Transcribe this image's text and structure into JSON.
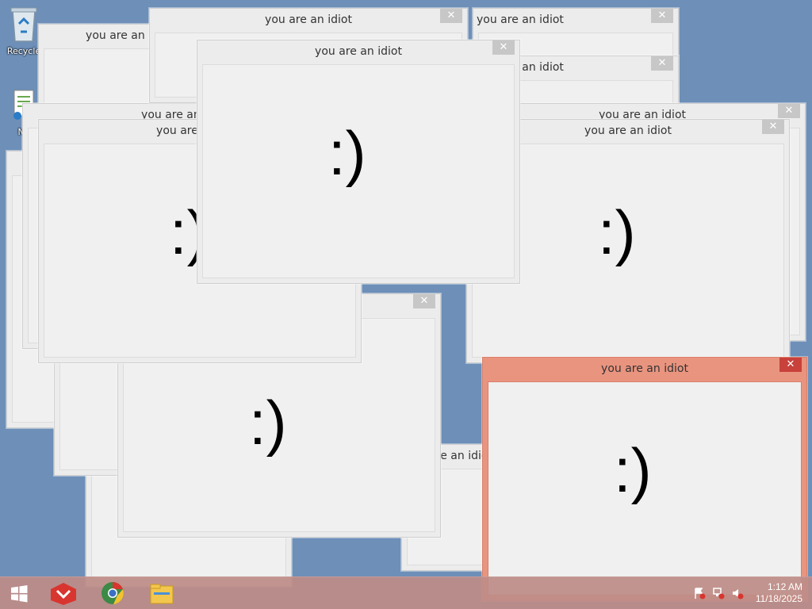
{
  "desktop": {
    "icons": [
      {
        "label": "Recycle",
        "icon": "recycle-bin-icon"
      },
      {
        "label": "No",
        "icon": "notepad-file-icon"
      }
    ]
  },
  "popup": {
    "title": "you are an idiot",
    "face": ":)",
    "close_glyph": "✕"
  },
  "taskbar": {
    "start_icon": "windows-start-icon",
    "pinned": [
      {
        "icon": "red-app-icon"
      },
      {
        "icon": "chrome-icon"
      },
      {
        "icon": "file-explorer-icon"
      }
    ],
    "tray": [
      {
        "icon": "action-center-flag-icon"
      },
      {
        "icon": "network-icon"
      },
      {
        "icon": "volume-muted-icon"
      }
    ],
    "time": "1:12 AM",
    "date": "11/18/2025"
  },
  "colors": {
    "active_frame": "#e9947f",
    "active_close": "#c8413b",
    "inactive_frame": "#ececec",
    "taskbar": "#be8c87"
  }
}
